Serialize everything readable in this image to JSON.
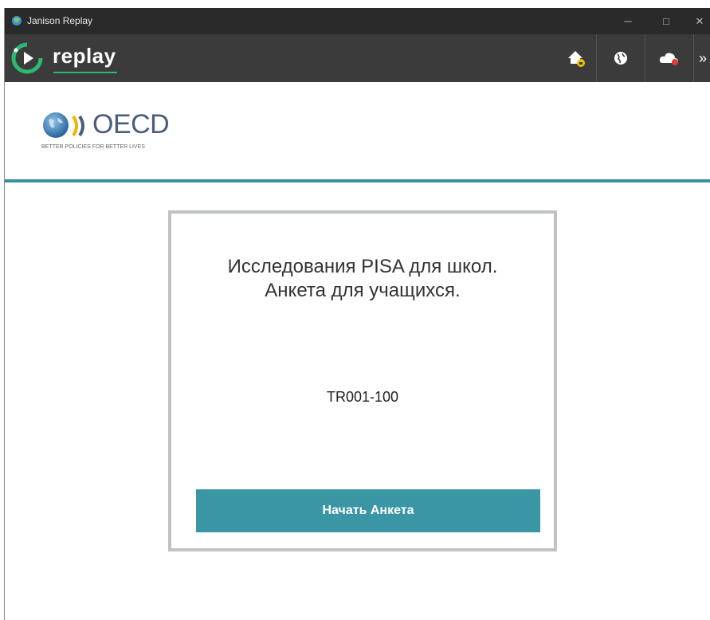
{
  "window": {
    "title": "Janison Replay",
    "controls": {
      "minimize_glyph": "─",
      "maximize_glyph": "□",
      "close_glyph": "✕"
    }
  },
  "appbar": {
    "brand": "replay",
    "tools": [
      {
        "name": "home-icon",
        "badge_icon": "lock-badge-icon"
      },
      {
        "name": "globe-icon"
      },
      {
        "name": "cloud-icon",
        "badge_icon": "status-dot-icon"
      }
    ],
    "more_glyph": "»"
  },
  "oecd": {
    "name": "OECD",
    "tagline": "BETTER POLICIES FOR BETTER LIVES"
  },
  "card": {
    "title_line1": "Исследования PISA для школ.",
    "title_line2": "Анкета для учащихся.",
    "code": "TR001-100",
    "start_label": "Начать Анкета"
  },
  "colors": {
    "titlebar": "#2a2a2a",
    "appbar": "#3b3b3b",
    "brand_accent": "#2eb872",
    "teal_rule": "#3a8fa0",
    "button": "#3a95a5",
    "card_border": "#bfc3c4"
  }
}
